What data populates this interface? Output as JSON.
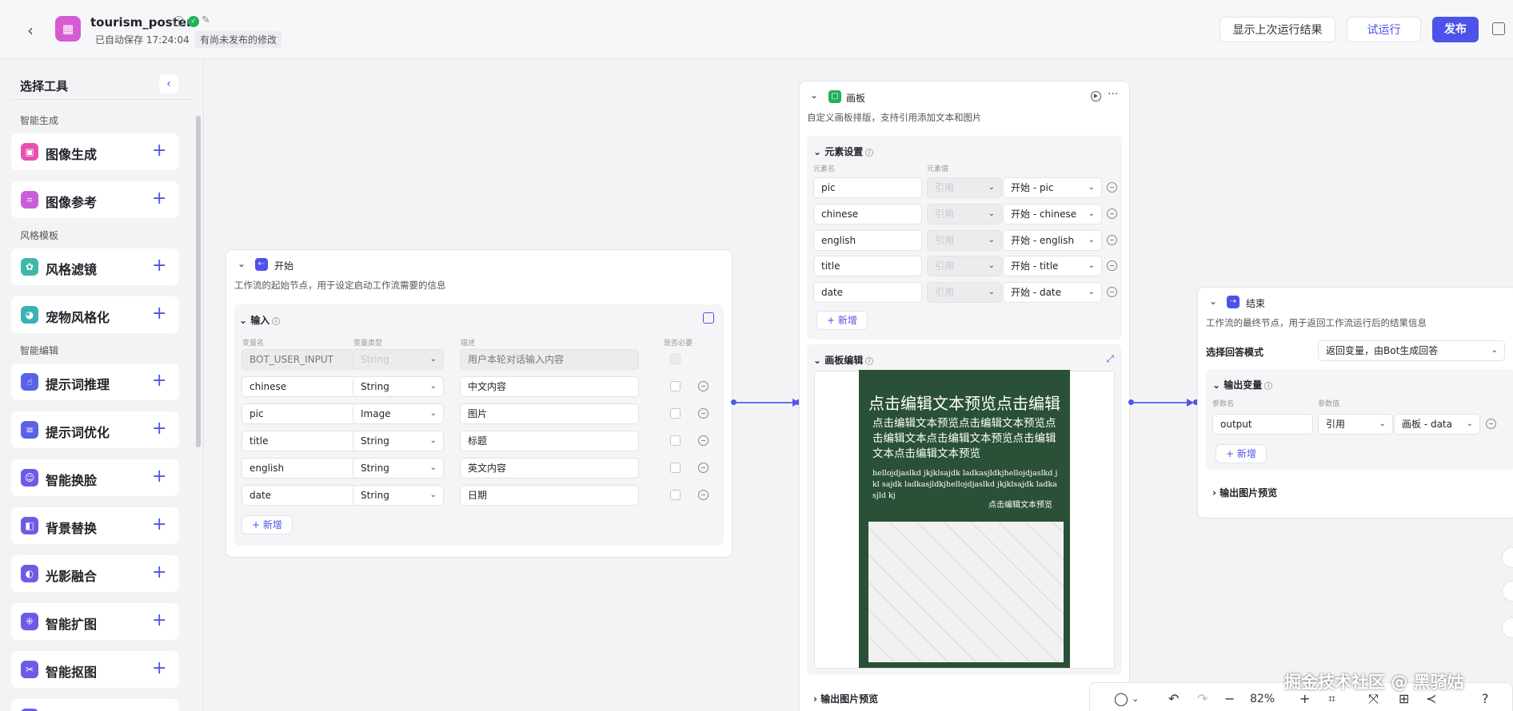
{
  "header": {
    "app_title": "tourism_poster",
    "saved_text": "已自动保存 17:24:04",
    "unpublished_text": "有尚未发布的修改",
    "show_last_run": "显示上次运行结果",
    "try_run": "试运行",
    "publish": "发布"
  },
  "sidebar": {
    "title": "选择工具",
    "categories": [
      "智能生成",
      "风格模板",
      "智能编辑"
    ],
    "items": [
      {
        "label": "图像生成",
        "color": "#e94fb0"
      },
      {
        "label": "图像参考",
        "color": "#c85fd9"
      },
      {
        "label": "风格滤镜",
        "color": "#3fb8a8"
      },
      {
        "label": "宠物风格化",
        "color": "#38b3b6"
      },
      {
        "label": "提示词推理",
        "color": "#5b62e6"
      },
      {
        "label": "提示词优化",
        "color": "#5b62e6"
      },
      {
        "label": "智能换脸",
        "color": "#6a5ce6"
      },
      {
        "label": "背景替换",
        "color": "#6a5ce6"
      },
      {
        "label": "光影融合",
        "color": "#6a5ce6"
      },
      {
        "label": "智能扩图",
        "color": "#6a5ce6"
      },
      {
        "label": "智能抠图",
        "color": "#6a5ce6"
      }
    ]
  },
  "start_node": {
    "title": "开始",
    "description": "工作流的起始节点，用于设定启动工作流需要的信息",
    "input_title": "输入",
    "columns": [
      "变量名",
      "变量类型",
      "描述",
      "是否必要"
    ],
    "rows": [
      {
        "name": "BOT_USER_INPUT",
        "type": "String",
        "desc": "用户本轮对话输入内容"
      },
      {
        "name": "chinese",
        "type": "String",
        "desc": "中文内容"
      },
      {
        "name": "pic",
        "type": "Image",
        "desc": "图片"
      },
      {
        "name": "title",
        "type": "String",
        "desc": "标题"
      },
      {
        "name": "english",
        "type": "String",
        "desc": "英文内容"
      },
      {
        "name": "date",
        "type": "String",
        "desc": "日期"
      }
    ],
    "add_label": "新增"
  },
  "canvas_node": {
    "title": "画板",
    "description": "自定义画板排版，支持引用添加文本和图片",
    "elements_title": "元素设置",
    "columns": [
      "元素名",
      "元素值"
    ],
    "ref_label": "引用",
    "elements": [
      {
        "name": "pic",
        "value": "开始 - pic"
      },
      {
        "name": "chinese",
        "value": "开始 - chinese"
      },
      {
        "name": "english",
        "value": "开始 - english"
      },
      {
        "name": "title",
        "value": "开始 - title"
      },
      {
        "name": "date",
        "value": "开始 - date"
      }
    ],
    "add_label": "新增",
    "edit_title": "画板编辑",
    "output_preview": "输出图片预览",
    "poster": {
      "line1": "点击编辑文本预览点击编辑",
      "line2": "点击编辑文本预览点击编辑文本预览点击编辑文本点击编辑文本预览点击编辑文本点击编辑文本预览",
      "line3": "hellojdjaslkd jkjklsajdk ladkasjldkjhellojdjaslkd jkl sajdk ladkasjldkjhellojdjaslkd jkjklsajdk ladkasjld kj",
      "line4": "点击编辑文本预览"
    }
  },
  "end_node": {
    "title": "结束",
    "description": "工作流的最终节点，用于返回工作流运行后的结果信息",
    "mode_label": "选择回答模式",
    "mode_value": "返回变量，由Bot生成回答",
    "output_title": "输出变量",
    "columns": [
      "参数名",
      "参数值"
    ],
    "out_name": "output",
    "out_ref": "引用",
    "out_value": "画板 - data",
    "add_label": "新增",
    "preview": "输出图片预览"
  },
  "toolbar": {
    "zoom": "82%"
  },
  "watermark": "掘金技术社区 @ 黑骑姑"
}
